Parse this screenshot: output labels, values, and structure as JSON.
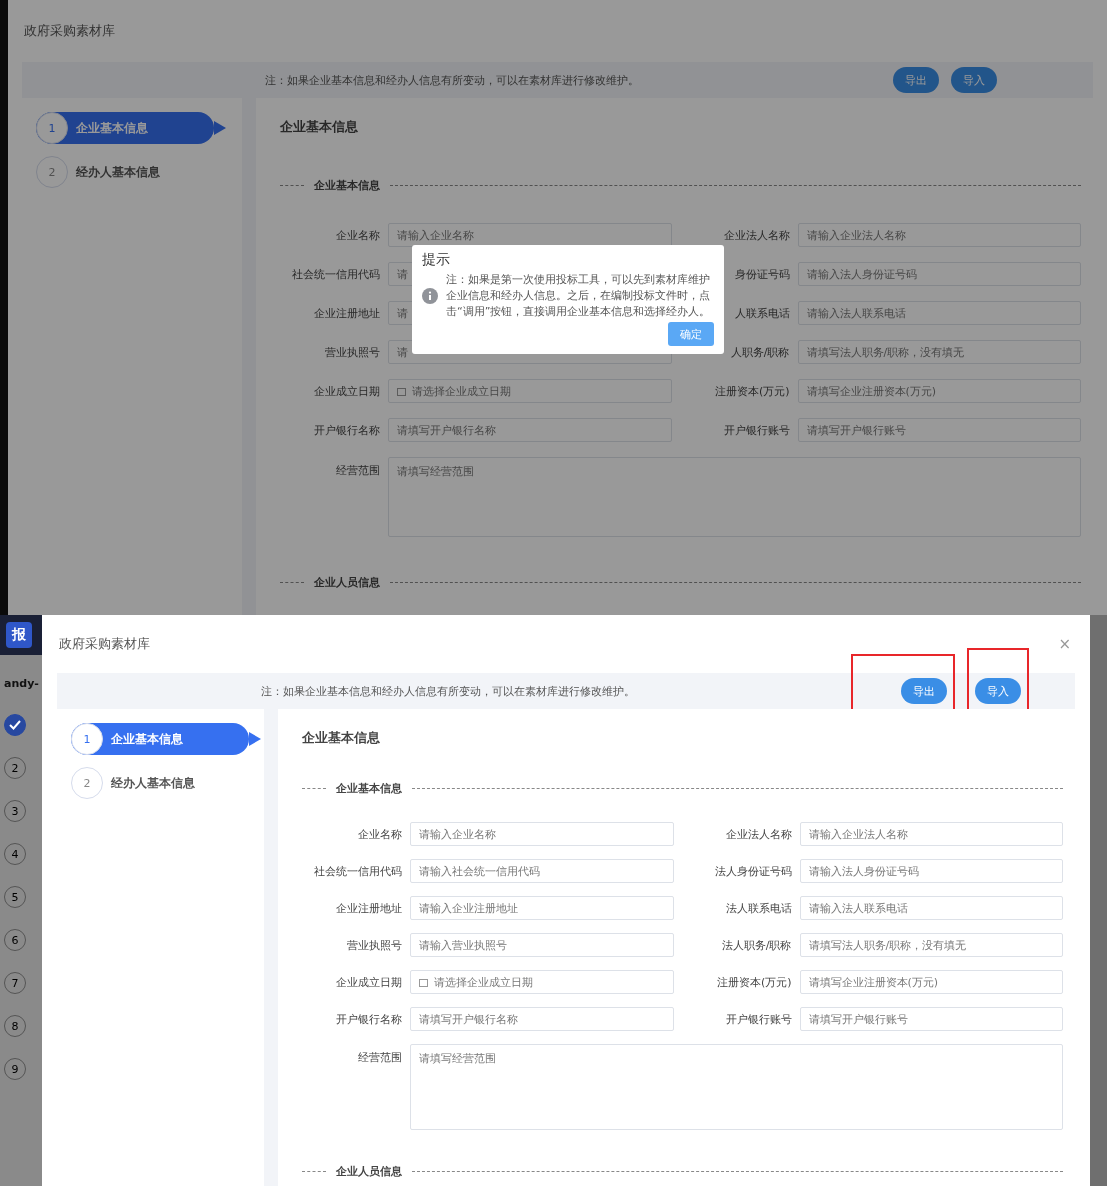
{
  "screens": [
    {
      "kind": "dimmed",
      "title": "政府采购素材库",
      "note": "注：如果企业基本信息和经办人信息有所变动，可以在素材库进行修改维护。",
      "buttons": [
        {
          "label": "导出",
          "highlighted": false
        },
        {
          "label": "导入",
          "highlighted": false
        }
      ],
      "steps": [
        {
          "number": "1",
          "label": "企业基本信息",
          "selected": true
        },
        {
          "number": "2",
          "label": "经办人基本信息",
          "selected": false
        }
      ],
      "section_title": "企业基本信息",
      "group_titles": [
        "企业基本信息",
        "企业人员信息"
      ],
      "fields": [
        {
          "kind": "input",
          "label": "企业名称",
          "placeholder": "请输入企业名称"
        },
        {
          "kind": "input",
          "label": "企业法人名称",
          "placeholder": "请输入企业法人名称"
        },
        {
          "kind": "input",
          "label": "社会统一信用代码",
          "placeholder": "请"
        },
        {
          "kind": "input",
          "label": "身份证号码",
          "placeholder": "请输入法人身份证号码"
        },
        {
          "kind": "input",
          "label": "企业注册地址",
          "placeholder": "请"
        },
        {
          "kind": "input",
          "label": "人联系电话",
          "placeholder": "请输入法人联系电话"
        },
        {
          "kind": "input",
          "label": "营业执照号",
          "placeholder": "请"
        },
        {
          "kind": "input",
          "label": "人职务/职称",
          "placeholder": "请填写法人职务/职称，没有填无"
        },
        {
          "kind": "date",
          "label": "企业成立日期",
          "placeholder": "请选择企业成立日期"
        },
        {
          "kind": "input",
          "label": "注册资本(万元)",
          "placeholder": "请填写企业注册资本(万元)"
        },
        {
          "kind": "input",
          "label": "开户银行名称",
          "placeholder": "请填写开户银行名称"
        },
        {
          "kind": "input",
          "label": "开户银行账号",
          "placeholder": "请填写开户银行账号"
        },
        {
          "kind": "textarea",
          "label": "经营范围",
          "placeholder": "请填写经营范围"
        }
      ],
      "modal": {
        "title": "提示",
        "message": "注：如果是第一次使用投标工具，可以先到素材库维护企业信息和经办人信息。之后，在编制投标文件时，点击“调用”按钮，直接调用企业基本信息和选择经办人。",
        "button": "确定"
      }
    },
    {
      "kind": "plain",
      "title": "政府采购素材库",
      "close": "×",
      "note": "注：如果企业基本信息和经办人信息有所变动，可以在素材库进行修改维护。",
      "buttons": [
        {
          "label": "导出",
          "highlighted": true
        },
        {
          "label": "导入",
          "highlighted": true
        }
      ],
      "steps": [
        {
          "number": "1",
          "label": "企业基本信息",
          "selected": true
        },
        {
          "number": "2",
          "label": "经办人基本信息",
          "selected": false
        }
      ],
      "section_title": "企业基本信息",
      "group_titles": [
        "企业基本信息",
        "企业人员信息"
      ],
      "fields": [
        {
          "kind": "input",
          "label": "企业名称",
          "placeholder": "请输入企业名称"
        },
        {
          "kind": "input",
          "label": "企业法人名称",
          "placeholder": "请输入企业法人名称"
        },
        {
          "kind": "input",
          "label": "社会统一信用代码",
          "placeholder": "请输入社会统一信用代码"
        },
        {
          "kind": "input",
          "label": "法人身份证号码",
          "placeholder": "请输入法人身份证号码"
        },
        {
          "kind": "input",
          "label": "企业注册地址",
          "placeholder": "请输入企业注册地址"
        },
        {
          "kind": "input",
          "label": "法人联系电话",
          "placeholder": "请输入法人联系电话"
        },
        {
          "kind": "input",
          "label": "营业执照号",
          "placeholder": "请输入营业执照号"
        },
        {
          "kind": "input",
          "label": "法人职务/职称",
          "placeholder": "请填写法人职务/职称，没有填无"
        },
        {
          "kind": "date",
          "label": "企业成立日期",
          "placeholder": "请选择企业成立日期"
        },
        {
          "kind": "input",
          "label": "注册资本(万元)",
          "placeholder": "请填写企业注册资本(万元)"
        },
        {
          "kind": "input",
          "label": "开户银行名称",
          "placeholder": "请填写开户银行名称"
        },
        {
          "kind": "input",
          "label": "开户银行账号",
          "placeholder": "请填写开户银行账号"
        },
        {
          "kind": "textarea",
          "label": "经营范围",
          "placeholder": "请填写经营范围"
        }
      ],
      "background_app": {
        "logo": "报",
        "user": "andy-",
        "steps": [
          {
            "kind": "done"
          },
          {
            "kind": "number",
            "label": "2"
          },
          {
            "kind": "number",
            "label": "3"
          },
          {
            "kind": "number",
            "label": "4"
          },
          {
            "kind": "number",
            "label": "5"
          },
          {
            "kind": "number",
            "label": "6"
          },
          {
            "kind": "number",
            "label": "7"
          },
          {
            "kind": "number",
            "label": "8"
          },
          {
            "kind": "number",
            "label": "9"
          }
        ]
      }
    }
  ]
}
